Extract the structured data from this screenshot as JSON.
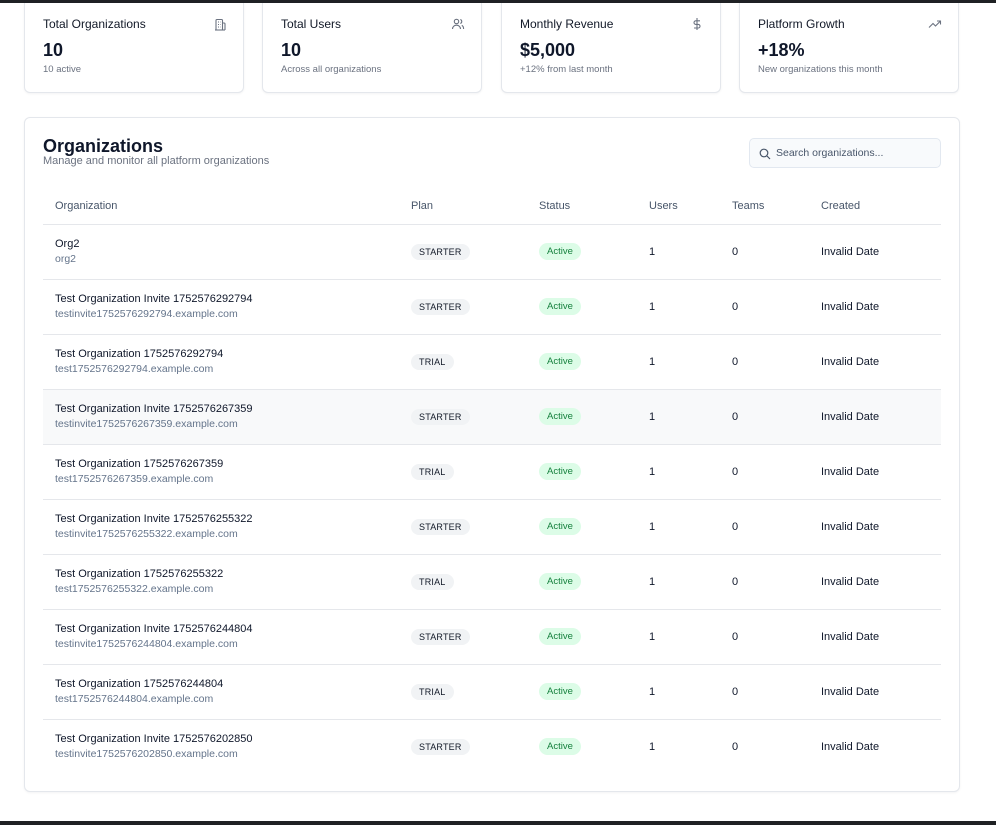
{
  "stats": [
    {
      "title": "Total Organizations",
      "value": "10",
      "sub": "10 active",
      "icon": "building-icon"
    },
    {
      "title": "Total Users",
      "value": "10",
      "sub": "Across all organizations",
      "icon": "users-icon"
    },
    {
      "title": "Monthly Revenue",
      "value": "$5,000",
      "sub": "+12% from last month",
      "icon": "dollar-icon"
    },
    {
      "title": "Platform Growth",
      "value": "+18%",
      "sub": "New organizations this month",
      "icon": "trending-up-icon"
    }
  ],
  "panel": {
    "title": "Organizations",
    "subtitle": "Manage and monitor all platform organizations",
    "search_placeholder": "Search organizations..."
  },
  "table": {
    "headers": [
      "Organization",
      "Plan",
      "Status",
      "Users",
      "Teams",
      "Created"
    ],
    "rows": [
      {
        "name": "Org2",
        "slug": "org2",
        "plan": "STARTER",
        "status": "Active",
        "users": "1",
        "teams": "0",
        "created": "Invalid Date"
      },
      {
        "name": "Test Organization Invite 1752576292794",
        "slug": "testinvite1752576292794.example.com",
        "plan": "STARTER",
        "status": "Active",
        "users": "1",
        "teams": "0",
        "created": "Invalid Date"
      },
      {
        "name": "Test Organization 1752576292794",
        "slug": "test1752576292794.example.com",
        "plan": "TRIAL",
        "status": "Active",
        "users": "1",
        "teams": "0",
        "created": "Invalid Date"
      },
      {
        "name": "Test Organization Invite 1752576267359",
        "slug": "testinvite1752576267359.example.com",
        "plan": "STARTER",
        "status": "Active",
        "users": "1",
        "teams": "0",
        "created": "Invalid Date"
      },
      {
        "name": "Test Organization 1752576267359",
        "slug": "test1752576267359.example.com",
        "plan": "TRIAL",
        "status": "Active",
        "users": "1",
        "teams": "0",
        "created": "Invalid Date"
      },
      {
        "name": "Test Organization Invite 1752576255322",
        "slug": "testinvite1752576255322.example.com",
        "plan": "STARTER",
        "status": "Active",
        "users": "1",
        "teams": "0",
        "created": "Invalid Date"
      },
      {
        "name": "Test Organization 1752576255322",
        "slug": "test1752576255322.example.com",
        "plan": "TRIAL",
        "status": "Active",
        "users": "1",
        "teams": "0",
        "created": "Invalid Date"
      },
      {
        "name": "Test Organization Invite 1752576244804",
        "slug": "testinvite1752576244804.example.com",
        "plan": "STARTER",
        "status": "Active",
        "users": "1",
        "teams": "0",
        "created": "Invalid Date"
      },
      {
        "name": "Test Organization 1752576244804",
        "slug": "test1752576244804.example.com",
        "plan": "TRIAL",
        "status": "Active",
        "users": "1",
        "teams": "0",
        "created": "Invalid Date"
      },
      {
        "name": "Test Organization Invite 1752576202850",
        "slug": "testinvite1752576202850.example.com",
        "plan": "STARTER",
        "status": "Active",
        "users": "1",
        "teams": "0",
        "created": "Invalid Date"
      }
    ]
  },
  "colors": {
    "status_active_bg": "#dcfce7",
    "status_active_text": "#15803d",
    "plan_badge_bg": "#f1f3f5"
  }
}
